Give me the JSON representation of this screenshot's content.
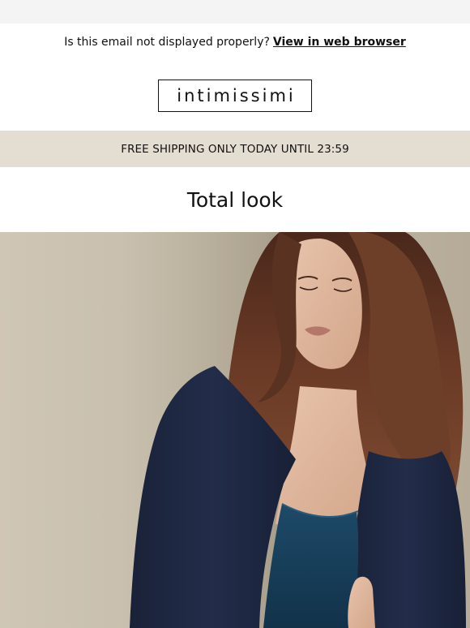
{
  "preheader": {
    "text": "Is this email not displayed properly?",
    "link_label": "View in web browser"
  },
  "brand": {
    "logo_text": "intimissimi"
  },
  "banner": {
    "text": "FREE SHIPPING ONLY TODAY UNTIL 23:59"
  },
  "main": {
    "headline": "Total look"
  },
  "colors": {
    "banner_bg": "#e4ddd2",
    "topbar_bg": "#f4f4f4",
    "jacket": "#1c2640",
    "camisole": "#163a55",
    "hair": "#5a3222",
    "wall": "#c7beae"
  }
}
